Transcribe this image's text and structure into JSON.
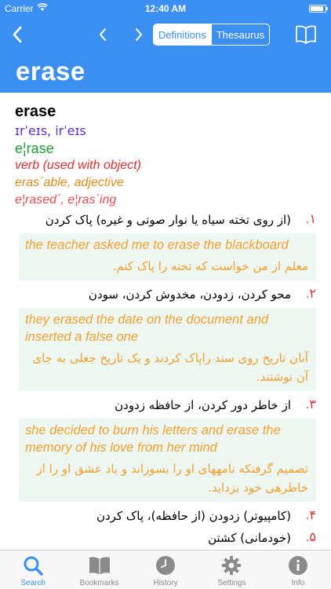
{
  "status": {
    "carrier": "Carrier",
    "time": "12:40 AM"
  },
  "nav": {
    "definitions_label": "Definitions",
    "thesaurus_label": "Thesaurus"
  },
  "word": "erase",
  "entry": {
    "headword": "erase",
    "pronunciation": "ɪrˈeɪs, irˈeɪs",
    "syllables": "e¦rase",
    "part_of_speech": "verb (used with object)",
    "derivative": "eras´able, adjective",
    "forms": "e¦rased´, e¦ras´ing"
  },
  "senses": [
    {
      "num": "۱.",
      "text": "(از روی تخته سیاه یا نوار صوتی و غیره) پاک کردن",
      "example_en": "the teacher asked me to erase the blackboard",
      "example_fa": "معلم از من خواست که تخته را پاک کنم."
    },
    {
      "num": "۲.",
      "text": "محو کردن، زدودن، مخدوش کردن، سودن",
      "example_en": "they erased the date on the document and inserted a false one",
      "example_fa": "آنان تاریخ روی سند راپاک کردند و یک تاریخ جعلی به جای آن نوشتند."
    },
    {
      "num": "۳.",
      "text": "از خاطر دور کردن، از حافظه زدودن",
      "example_en": "she decided to burn his letters and erase the memory of his love from her mind",
      "example_fa": "تصمیم گرفتکه نامههای او را بسوزاند و یاد عشق او را از خاطرهی خود بزداید."
    },
    {
      "num": "۴.",
      "text": "(کامپیوتر) زدودن (از حافظه)، پاک کردن"
    },
    {
      "num": "۵.",
      "text": "(خودمانی) کشتن"
    }
  ],
  "tabs": [
    {
      "label": "Search",
      "icon": "search-icon",
      "active": true
    },
    {
      "label": "Bookmarks",
      "icon": "bookmarks-icon",
      "active": false
    },
    {
      "label": "History",
      "icon": "history-clock-icon",
      "active": false
    },
    {
      "label": "Settings",
      "icon": "gear-icon",
      "active": false
    },
    {
      "label": "Info",
      "icon": "info-icon",
      "active": false
    }
  ],
  "colors": {
    "accent": "#3b8ff0",
    "sense_number": "#d93030",
    "example": "#f0a030",
    "pronunciation": "#5a2fd0",
    "syllables": "#1e9a3a"
  }
}
